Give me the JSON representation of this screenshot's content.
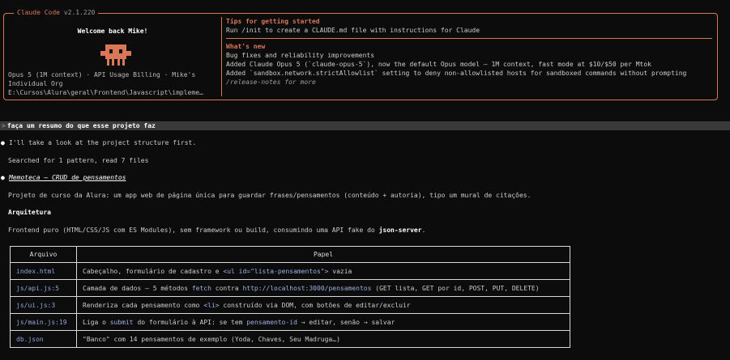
{
  "header": {
    "app_name": "Claude Code",
    "version": "v2.1.220",
    "welcome": "Welcome back Mike!",
    "model_info": "Opus 5 (1M context) · API Usage Billing · Mike's Individual Org",
    "path": "E:\\Cursos\\Alura\\geral\\Frontend\\Javascript\\impleme…"
  },
  "tips": {
    "title": "Tips for getting started",
    "text": "Run /init to create a CLAUDE.md file with instructions for Claude"
  },
  "whats_new": {
    "title": "What's new",
    "items": [
      "Bug fixes and reliability improvements",
      "Added Claude Opus 5 (`claude-opus-5`), now the default Opus model — 1M context, fast mode at $10/$50 per Mtok",
      "Added `sandbox.network.strictAllowlist` setting to deny non-allowlisted hosts for sandboxed commands without prompting"
    ],
    "release_notes": "/release-notes for more"
  },
  "prompt": {
    "symbol": ">",
    "text": "faça um resumo do que esse projeto faz"
  },
  "conversation": {
    "msg1": "I'll take a look at the project structure first.",
    "tool_summary": "Searched for 1 pattern, read 7 files",
    "project_title": "Memoteca — CRUD de pensamentos",
    "description": "Projeto de curso da Alura: um app web de página única para guardar frases/pensamentos (conteúdo + autoria), tipo um mural de citações.",
    "arch_heading": "Arquitetura",
    "arch_text_before": "Frontend puro (HTML/CSS/JS com ES Modules), sem framework ou build, consumindo uma API fake do ",
    "arch_text_bold": "json-server",
    "arch_text_after": "."
  },
  "table": {
    "headers": [
      "Arquivo",
      "Papel"
    ],
    "rows": [
      {
        "file": "index.html",
        "p1": "Cabeçalho, formulário de cadastro e ",
        "c1": "<ul id=\"lista-pensamentos\">",
        "p2": " vazia",
        "c2": "",
        "p3": "",
        "c3": "",
        "p4": "",
        "c4": "",
        "p5": ""
      },
      {
        "file": "js/api.js:5",
        "p1": "Camada de dados — 5 métodos ",
        "c1": "fetch",
        "p2": " contra ",
        "c2": "http://localhost:3000/pensamentos",
        "p3": " (GET lista, GET por id, POST, PUT, DELETE)",
        "c3": "",
        "p4": "",
        "c4": "",
        "p5": ""
      },
      {
        "file": "js/ui.js:3",
        "p1": "Renderiza cada pensamento como ",
        "c1": "<li>",
        "p2": " construído via DOM, com botões de editar/excluir",
        "c2": "",
        "p3": "",
        "c3": "",
        "p4": "",
        "c4": "",
        "p5": ""
      },
      {
        "file": "js/main.js:19",
        "p1": "Liga o ",
        "c1": "submit",
        "p2": " do formulário à API: se tem ",
        "c2": "pensamento-id",
        "p3": " → editar, senão → salvar",
        "c3": "",
        "p4": "",
        "c4": "",
        "p5": ""
      },
      {
        "file": "db.json",
        "p1": "\"Banco\" com 14 pensamentos de exemplo (Yoda, Chaves, Seu Madruga…)",
        "c1": "",
        "p2": "",
        "c2": "",
        "p3": "",
        "c3": "",
        "p4": "",
        "c4": "",
        "p5": ""
      }
    ]
  },
  "colors": {
    "accent": "#d97757",
    "background": "#0c0c0c",
    "code": "#9fb0e0"
  }
}
